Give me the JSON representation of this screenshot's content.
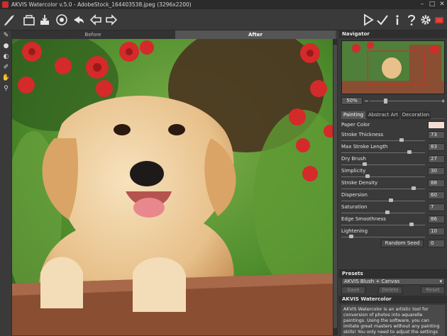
{
  "window": {
    "title": "AKVIS Watercolor v.5.0 - AdobeStock_164403538.jpeg (3296x2200)",
    "minimize": "–",
    "maximize": "□",
    "close": "✕"
  },
  "toolbar": {
    "left_icons": [
      "open-file-icon",
      "save-icon",
      "print-icon",
      "share-icon",
      "undo-icon",
      "redo-icon"
    ],
    "right_icons": [
      "run-icon",
      "apply-icon",
      "info-icon",
      "help-icon",
      "settings-icon",
      "about-icon"
    ]
  },
  "canvas_tabs": {
    "before": "Before",
    "after": "After"
  },
  "navigator": {
    "title": "Navigator",
    "zoom": "50%"
  },
  "panel_tabs": [
    "Painting",
    "Abstract Art",
    "Decoration"
  ],
  "settings": {
    "paper_color_label": "Paper Color",
    "paper_color": "#f6ddd3",
    "params": [
      {
        "label": "Stroke Thickness",
        "value": "73",
        "fraction": 0.73
      },
      {
        "label": "Max Stroke Length",
        "value": "83",
        "fraction": 0.83
      },
      {
        "label": "Dry Brush",
        "value": "27",
        "fraction": 0.27
      },
      {
        "label": "Simplicity",
        "value": "30",
        "fraction": 0.3
      },
      {
        "label": "Stroke Density",
        "value": "88",
        "fraction": 0.88
      },
      {
        "label": "Dispersion",
        "value": "60",
        "fraction": 0.6
      },
      {
        "label": "Saturation",
        "value": "7",
        "fraction": 0.55
      },
      {
        "label": "Edge Smoothness",
        "value": "86",
        "fraction": 0.86
      },
      {
        "label": "Lightening",
        "value": "10",
        "fraction": 0.1
      }
    ],
    "random_seed_label": "Random Seed",
    "random_seed_value": "0"
  },
  "presets": {
    "title": "Presets",
    "selected": "AKVIS Blush + Canvas",
    "save": "Save",
    "delete": "Delete",
    "reset": "Reset"
  },
  "info": {
    "title": "AKVIS Watercolor",
    "text": "AKVIS Watercolor is an artistic tool for conversion of photos into aquarelle paintings. Using the software, you can imitate great masters without any painting skills! You only need to adjust the settings to your taste and run the processing."
  },
  "colors": {
    "accent": "#c9302c",
    "panel": "#3a3a3a",
    "paper": "#f6ddd3"
  }
}
